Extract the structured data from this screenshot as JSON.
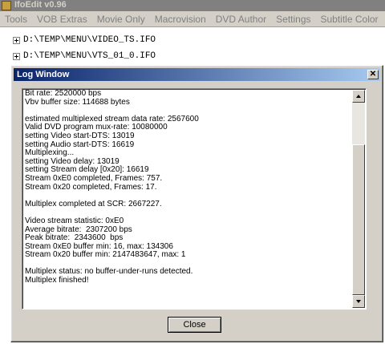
{
  "app": {
    "title": "IfoEdit v0.96"
  },
  "menu": [
    "Tools",
    "VOB Extras",
    "Movie Only",
    "Macrovision",
    "DVD Author",
    "Settings",
    "Subtitle Color"
  ],
  "tree": [
    "D:\\TEMP\\MENU\\VIDEO_TS.IFO",
    "D:\\TEMP\\MENU\\VTS_01_0.IFO"
  ],
  "log_window": {
    "title": "Log Window",
    "close_glyph": "✕",
    "lines": [
      "Bit rate: 2520000 bps",
      "Vbv buffer size: 114688 bytes",
      "",
      "estimated multiplexed stream data rate: 2567600",
      "Valid DVD program mux-rate: 10080000",
      "setting Video start-DTS: 13019",
      "setting Audio start-DTS: 16619",
      "Multiplexing...",
      "setting Video delay: 13019",
      "setting Stream delay [0x20]: 16619",
      "Stream 0xE0 completed, Frames: 757.",
      "Stream 0x20 completed, Frames: 17.",
      "",
      "Multiplex completed at SCR: 2667227.",
      "",
      "Video stream statistic: 0xE0",
      "Average bitrate:  2307200 bps",
      "Peak bitrate:  2343600  bps",
      "Stream 0xE0 buffer min: 16, max: 134306",
      "Stream 0x20 buffer min: 2147483647, max: 1",
      "",
      "Multiplex status: no buffer-under-runs detected.",
      "Multiplex finished!"
    ],
    "close_button": "Close"
  }
}
